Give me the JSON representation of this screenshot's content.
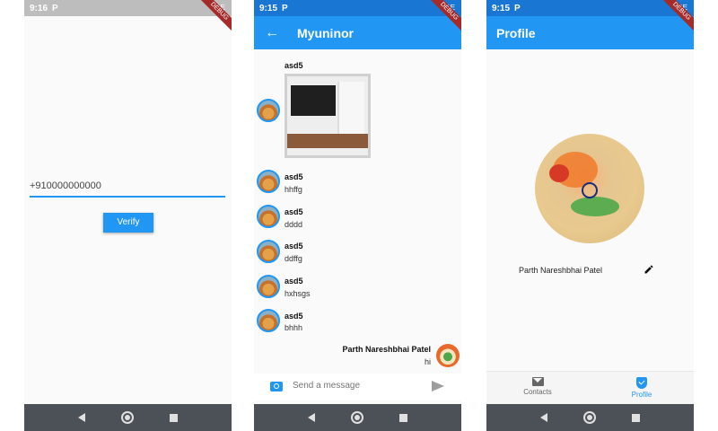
{
  "screen1": {
    "status": {
      "time": "9:16",
      "indicator": "P",
      "right": "LTE"
    },
    "phone_value": "+910000000000",
    "verify_label": "Verify",
    "debug_label": "DEBUG"
  },
  "screen2": {
    "status": {
      "time": "9:15",
      "indicator": "P",
      "right": "LTE"
    },
    "title": "Myuninor",
    "debug_label": "DEBUG",
    "messages": [
      {
        "name": "asd5",
        "text": ""
      },
      {
        "name": "asd5",
        "text": "hhffg"
      },
      {
        "name": "asd5",
        "text": "dddd"
      },
      {
        "name": "asd5",
        "text": "ddffg"
      },
      {
        "name": "asd5",
        "text": "hxhsgs"
      },
      {
        "name": "asd5",
        "text": "bhhh"
      },
      {
        "name": "Parth Nareshbhai Patel",
        "text": "hi"
      }
    ],
    "input_placeholder": "Send a message"
  },
  "screen3": {
    "status": {
      "time": "9:15",
      "indicator": "P",
      "right": "LTE"
    },
    "title": "Profile",
    "debug_label": "DEBUG",
    "profile_name": "Parth Nareshbhai Patel",
    "nav": {
      "contacts": "Contacts",
      "profile": "Profile"
    }
  },
  "colors": {
    "primary": "#2196f3",
    "status_dark": "#1976d2",
    "navbar": "#4c5157"
  }
}
